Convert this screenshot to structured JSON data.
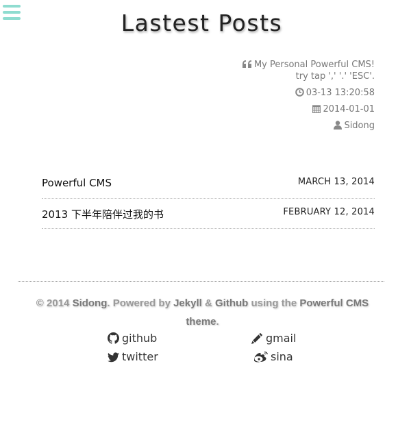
{
  "header": {
    "menu_icon": "hamburger-menu-icon",
    "title": "Lastest Posts"
  },
  "meta": {
    "quote_line1": "My Personal Powerful CMS!",
    "quote_line2": "try tap ',' '.' 'ESC'.",
    "time": "03-13 13:20:58",
    "date": "2014-01-01",
    "author": "Sidong"
  },
  "posts": [
    {
      "title": "Powerful CMS",
      "date": "MARCH 13, 2014"
    },
    {
      "title": "2013 下半年陪伴过我的书",
      "date": "FEBRUARY 12, 2014"
    }
  ],
  "footer": {
    "copyright": "© 2014",
    "owner": "Sidong",
    "powered": ". Powered by",
    "jekyll": "Jekyll",
    "amp": "&",
    "github": "Github",
    "using": "using the",
    "theme": "Powerful CMS theme",
    "end": "."
  },
  "links": {
    "github": "github",
    "gmail": "gmail",
    "twitter": "twitter",
    "sina": "sina"
  },
  "colors": {
    "accent": "#8fdcd0"
  }
}
